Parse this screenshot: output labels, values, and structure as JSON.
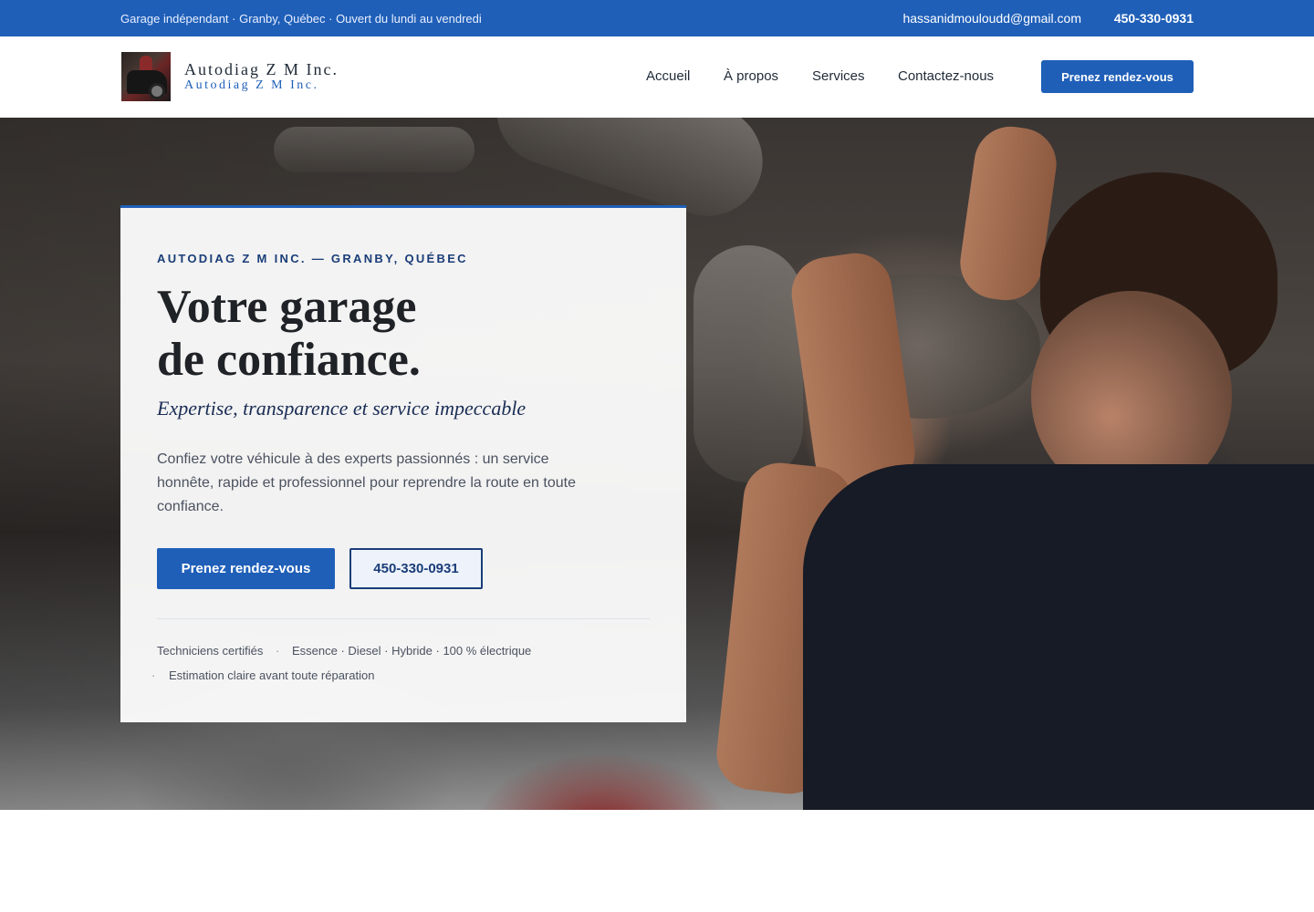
{
  "topbar": {
    "tagline": "Garage indépendant · Granby, Québec · Ouvert du lundi au vendredi",
    "email": "hassanidmouloudd@gmail.com",
    "phone": "450-330-0931"
  },
  "header": {
    "brand_name": "Autodiag Z M Inc.",
    "brand_sub": "Autodiag Z M Inc.",
    "nav": [
      {
        "label": "Accueil"
      },
      {
        "label": "À propos"
      },
      {
        "label": "Services"
      },
      {
        "label": "Contactez-nous"
      }
    ],
    "cta_label": "Prenez rendez-vous"
  },
  "hero": {
    "eyebrow": "AUTODIAG Z M INC. — GRANBY, QUÉBEC",
    "title_line1": "Votre garage",
    "title_line2": "de confiance.",
    "tagline": "Expertise, transparence et service impeccable",
    "description": "Confiez votre véhicule à des experts passionnés : un service honnête, rapide et professionnel pour reprendre la route en toute confiance.",
    "primary_button": "Prenez rendez-vous",
    "phone_button": "450-330-0931",
    "features": [
      "Techniciens certifiés",
      "Essence · Diesel · Hybride · 100 % électrique",
      "Estimation claire avant toute réparation"
    ],
    "separator": "·"
  },
  "colors": {
    "accent": "#1f5fb8",
    "navy": "#1a3d78",
    "text": "#1f2a37"
  }
}
